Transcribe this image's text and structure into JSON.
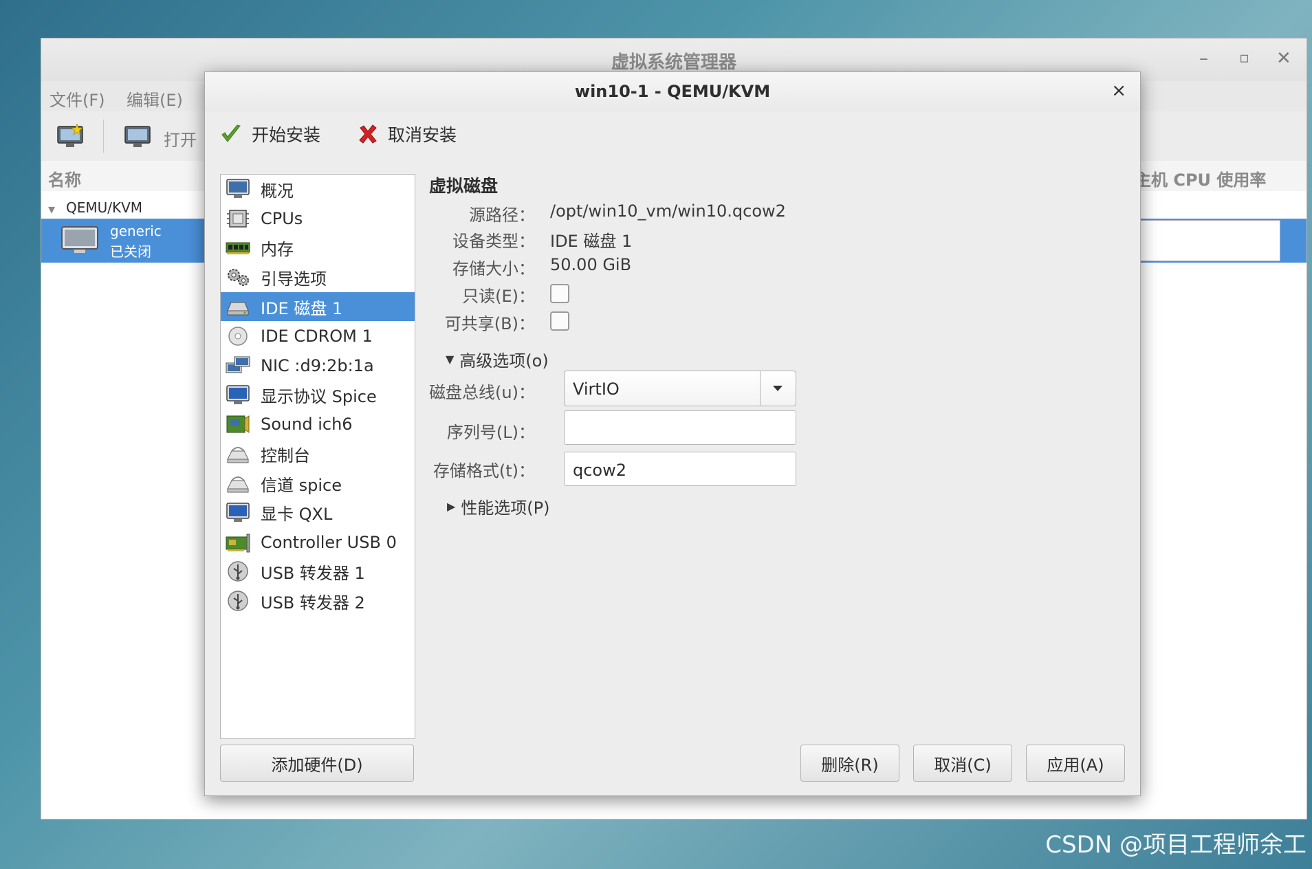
{
  "main_window": {
    "title": "虚拟系统管理器",
    "menu": [
      "文件(F)",
      "编辑(E)"
    ],
    "toolbar_open": "打开",
    "col_name": "名称",
    "col_cpu": "主机 CPU 使用率",
    "group": "QEMU/KVM",
    "vm_name": "generic",
    "vm_state": "已关闭",
    "controls": {
      "minimize": "–",
      "maximize": "▫",
      "close": "✕"
    }
  },
  "dialog": {
    "title": "win10-1 - QEMU/KVM",
    "close": "×",
    "begin_install": "开始安装",
    "cancel_install": "取消安装"
  },
  "hardware": [
    {
      "label": "概况",
      "icon": "overview-icon"
    },
    {
      "label": "CPUs",
      "icon": "cpu-icon"
    },
    {
      "label": "内存",
      "icon": "memory-icon"
    },
    {
      "label": "引导选项",
      "icon": "boot-options-icon"
    },
    {
      "label": "IDE 磁盘 1",
      "icon": "disk-icon"
    },
    {
      "label": "IDE CDROM 1",
      "icon": "cdrom-icon"
    },
    {
      "label": "NIC :d9:2b:1a",
      "icon": "network-icon"
    },
    {
      "label": "显示协议 Spice",
      "icon": "display-icon"
    },
    {
      "label": "Sound ich6",
      "icon": "sound-icon"
    },
    {
      "label": "控制台",
      "icon": "console-icon"
    },
    {
      "label": "信道 spice",
      "icon": "channel-icon"
    },
    {
      "label": "显卡 QXL",
      "icon": "video-card-icon"
    },
    {
      "label": "Controller USB 0",
      "icon": "controller-icon"
    },
    {
      "label": "USB 转发器 1",
      "icon": "usb-redirector-icon"
    },
    {
      "label": "USB 转发器 2",
      "icon": "usb-redirector-icon"
    }
  ],
  "selected_index": 4,
  "disk": {
    "section": "虚拟磁盘",
    "source_label": "源路径：",
    "source": "/opt/win10_vm/win10.qcow2",
    "device_label": "设备类型：",
    "device": "IDE 磁盘 1",
    "size_label": "存储大小：",
    "size": "50.00 GiB",
    "readonly_label": "只读(E)：",
    "readonly": false,
    "shareable_label": "可共享(B)：",
    "shareable": false,
    "advanced": "高级选项(o)",
    "bus_label": "磁盘总线(u)：",
    "bus": "VirtIO",
    "serial_label": "序列号(L)：",
    "serial": "",
    "format_label": "存储格式(t)：",
    "format": "qcow2",
    "perf": "性能选项(P)"
  },
  "buttons": {
    "add_hardware": "添加硬件(D)",
    "remove": "删除(R)",
    "cancel": "取消(C)",
    "apply": "应用(A)"
  },
  "watermark": "CSDN @项目工程师余工",
  "colors": {
    "selection": "#4a90d9",
    "install_check": "#5aa02c",
    "cancel_x": "#d32222"
  }
}
